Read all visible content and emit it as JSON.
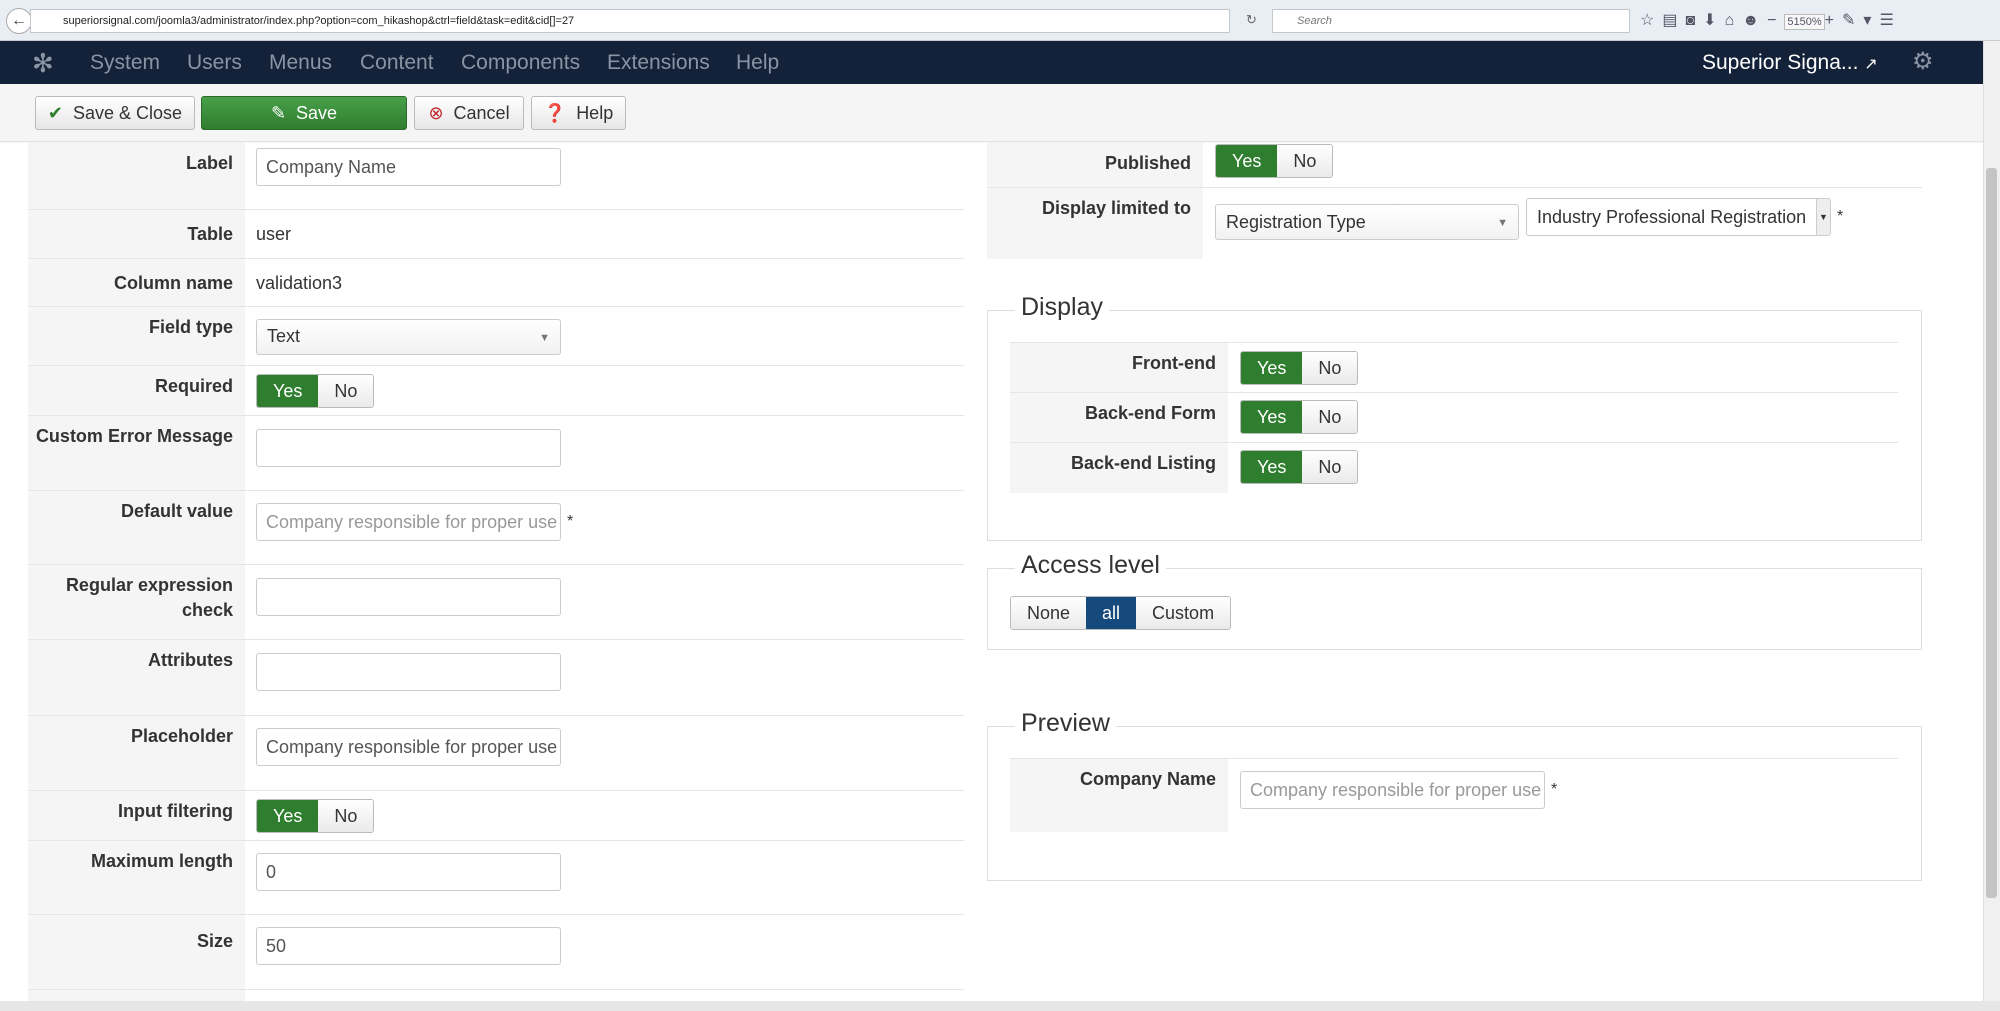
{
  "browser": {
    "url": "superiorsignal.com/joomla3/administrator/index.php?option=com_hikashop&ctrl=field&task=edit&cid[]=27",
    "search_placeholder": "Search",
    "zoom": "5150%"
  },
  "nav": {
    "items": [
      "System",
      "Users",
      "Menus",
      "Content",
      "Components",
      "Extensions",
      "Help"
    ],
    "site": "Superior Signa..."
  },
  "toolbar": {
    "save_close": "Save & Close",
    "save": "Save",
    "cancel": "Cancel",
    "help": "Help"
  },
  "colors": {
    "nav_bg": "#132238",
    "green": "#2f7d2f",
    "blue_active": "#174a7c"
  },
  "form": {
    "label": {
      "label": "Label",
      "value": "Company Name"
    },
    "table": {
      "label": "Table",
      "value": "user"
    },
    "column": {
      "label": "Column name",
      "value": "validation3"
    },
    "field_type": {
      "label": "Field type",
      "value": "Text"
    },
    "required": {
      "label": "Required",
      "yes": "Yes",
      "no": "No",
      "selected": "Yes"
    },
    "custom_error": {
      "label": "Custom Error Message",
      "value": ""
    },
    "default": {
      "label": "Default value",
      "placeholder": "Company responsible for proper use",
      "required_mark": "*"
    },
    "regex": {
      "label": "Regular expression check",
      "value": ""
    },
    "attributes": {
      "label": "Attributes",
      "value": ""
    },
    "placeholder": {
      "label": "Placeholder",
      "value": "Company responsible for proper use"
    },
    "input_filtering": {
      "label": "Input filtering",
      "yes": "Yes",
      "no": "No",
      "selected": "Yes"
    },
    "max_length": {
      "label": "Maximum length",
      "value": "0"
    },
    "size": {
      "label": "Size",
      "value": "50"
    }
  },
  "right": {
    "published": {
      "label": "Published",
      "yes": "Yes",
      "no": "No",
      "selected": "Yes"
    },
    "display_limited": {
      "label": "Display limited to",
      "select1": "Registration Type",
      "select2": "Industry Professional Registration",
      "required_mark": "*"
    },
    "display": {
      "legend": "Display",
      "rows": [
        {
          "label": "Front-end",
          "yes": "Yes",
          "no": "No",
          "selected": "Yes"
        },
        {
          "label": "Back-end Form",
          "yes": "Yes",
          "no": "No",
          "selected": "Yes"
        },
        {
          "label": "Back-end Listing",
          "yes": "Yes",
          "no": "No",
          "selected": "Yes"
        }
      ]
    },
    "access": {
      "legend": "Access level",
      "options": [
        "None",
        "all",
        "Custom"
      ],
      "selected": "all"
    },
    "preview": {
      "legend": "Preview",
      "label": "Company Name",
      "placeholder": "Company responsible for proper use",
      "required_mark": "*"
    }
  }
}
